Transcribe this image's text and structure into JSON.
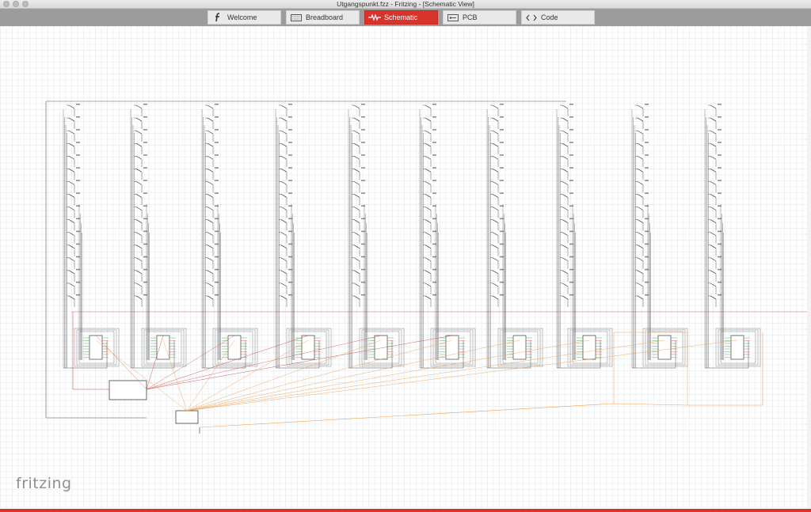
{
  "window": {
    "title": "Utgangspunkt.fzz - Fritzing - [Schematic View]"
  },
  "tabs": [
    {
      "label": "Welcome",
      "icon": "fritzing-f-icon",
      "active": false
    },
    {
      "label": "Breadboard",
      "icon": "breadboard-icon",
      "active": false
    },
    {
      "label": "Schematic",
      "icon": "schematic-icon",
      "active": true
    },
    {
      "label": "PCB",
      "icon": "pcb-icon",
      "active": false
    },
    {
      "label": "Code",
      "icon": "code-icon",
      "active": false
    }
  ],
  "logo": {
    "text": "fritzing"
  },
  "colors": {
    "accent": "#d9342b",
    "wire_gray": "#555555",
    "wire_red": "#d9534f",
    "wire_orange": "#f0a050"
  },
  "schematic": {
    "column_count": 10,
    "switches_per_column": 16,
    "shift_register_count": 10,
    "microcontroller_count": 1,
    "demux_count": 1
  }
}
